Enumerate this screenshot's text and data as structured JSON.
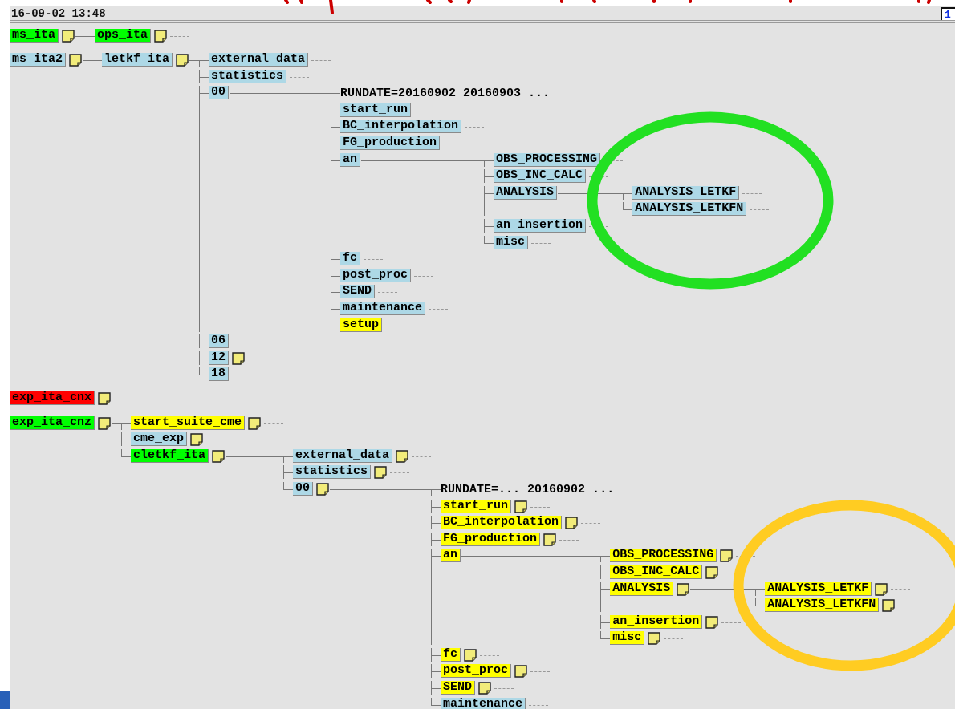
{
  "header": {
    "timestamp": "16-09-02 13:48",
    "page_button": "1"
  },
  "trees": [
    {
      "kind": "node",
      "name": "ms_ita",
      "color": "#00ff00",
      "note": true,
      "children": [
        {
          "kind": "node",
          "name": "ops_ita",
          "color": "#00ff00",
          "note": true
        }
      ]
    },
    {
      "kind": "node",
      "name": "ms_ita2",
      "color": "#add8e6",
      "note": true,
      "children": [
        {
          "kind": "node",
          "name": "letkf_ita",
          "color": "#add8e6",
          "note": true,
          "children": [
            {
              "kind": "node",
              "name": "external_data",
              "color": "#add8e6",
              "note": false
            },
            {
              "kind": "node",
              "name": "statistics",
              "color": "#add8e6",
              "note": false
            },
            {
              "kind": "node",
              "name": "00",
              "color": "#add8e6",
              "note": false,
              "children": [
                {
                  "kind": "label",
                  "text": "RUNDATE=20160902 20160903 ..."
                },
                {
                  "kind": "node",
                  "name": "start_run",
                  "color": "#add8e6",
                  "note": false
                },
                {
                  "kind": "node",
                  "name": "BC_interpolation",
                  "color": "#add8e6",
                  "note": false
                },
                {
                  "kind": "node",
                  "name": "FG_production",
                  "color": "#add8e6",
                  "note": false
                },
                {
                  "kind": "node",
                  "name": "an",
                  "color": "#add8e6",
                  "note": false,
                  "children": [
                    {
                      "kind": "node",
                      "name": "OBS_PROCESSING",
                      "color": "#add8e6",
                      "note": false
                    },
                    {
                      "kind": "node",
                      "name": "OBS_INC_CALC",
                      "color": "#add8e6",
                      "note": false
                    },
                    {
                      "kind": "node",
                      "name": "ANALYSIS",
                      "color": "#add8e6",
                      "note": false,
                      "children": [
                        {
                          "kind": "node",
                          "name": "ANALYSIS_LETKF",
                          "color": "#add8e6",
                          "note": false
                        },
                        {
                          "kind": "node",
                          "name": "ANALYSIS_LETKFN",
                          "color": "#add8e6",
                          "note": false
                        }
                      ]
                    },
                    {
                      "kind": "node",
                      "name": "an_insertion",
                      "color": "#add8e6",
                      "note": false
                    },
                    {
                      "kind": "node",
                      "name": "misc",
                      "color": "#add8e6",
                      "note": false
                    }
                  ]
                },
                {
                  "kind": "node",
                  "name": "fc",
                  "color": "#add8e6",
                  "note": false
                },
                {
                  "kind": "node",
                  "name": "post_proc",
                  "color": "#add8e6",
                  "note": false
                },
                {
                  "kind": "node",
                  "name": "SEND",
                  "color": "#add8e6",
                  "note": false
                },
                {
                  "kind": "node",
                  "name": "maintenance",
                  "color": "#add8e6",
                  "note": false
                },
                {
                  "kind": "node",
                  "name": "setup",
                  "color": "#ffff00",
                  "note": false
                }
              ]
            },
            {
              "kind": "node",
              "name": "06",
              "color": "#add8e6",
              "note": false
            },
            {
              "kind": "node",
              "name": "12",
              "color": "#add8e6",
              "note": true
            },
            {
              "kind": "node",
              "name": "18",
              "color": "#add8e6",
              "note": false
            }
          ]
        }
      ]
    },
    {
      "kind": "node",
      "name": "exp_ita_cnx",
      "color": "#ff0000",
      "note": true
    },
    {
      "kind": "node",
      "name": "exp_ita_cnz",
      "color": "#00ff00",
      "note": true,
      "children": [
        {
          "kind": "node",
          "name": "start_suite_cme",
          "color": "#ffff00",
          "note": true
        },
        {
          "kind": "node",
          "name": "cme_exp",
          "color": "#add8e6",
          "note": true
        },
        {
          "kind": "node",
          "name": "cletkf_ita",
          "color": "#00ff00",
          "note": true,
          "children": [
            {
              "kind": "node",
              "name": "external_data",
              "color": "#add8e6",
              "note": true
            },
            {
              "kind": "node",
              "name": "statistics",
              "color": "#add8e6",
              "note": true
            },
            {
              "kind": "node",
              "name": "00",
              "color": "#add8e6",
              "note": true,
              "children": [
                {
                  "kind": "label",
                  "text": "RUNDATE=... 20160902 ..."
                },
                {
                  "kind": "node",
                  "name": "start_run",
                  "color": "#ffff00",
                  "note": true
                },
                {
                  "kind": "node",
                  "name": "BC_interpolation",
                  "color": "#ffff00",
                  "note": true
                },
                {
                  "kind": "node",
                  "name": "FG_production",
                  "color": "#ffff00",
                  "note": true
                },
                {
                  "kind": "node",
                  "name": "an",
                  "color": "#ffff00",
                  "note": false,
                  "children": [
                    {
                      "kind": "node",
                      "name": "OBS_PROCESSING",
                      "color": "#ffff00",
                      "note": true
                    },
                    {
                      "kind": "node",
                      "name": "OBS_INC_CALC",
                      "color": "#ffff00",
                      "note": true
                    },
                    {
                      "kind": "node",
                      "name": "ANALYSIS",
                      "color": "#ffff00",
                      "note": true,
                      "children": [
                        {
                          "kind": "node",
                          "name": "ANALYSIS_LETKF",
                          "color": "#ffff00",
                          "note": true
                        },
                        {
                          "kind": "node",
                          "name": "ANALYSIS_LETKFN",
                          "color": "#ffff00",
                          "note": true
                        }
                      ]
                    },
                    {
                      "kind": "node",
                      "name": "an_insertion",
                      "color": "#ffff00",
                      "note": true
                    },
                    {
                      "kind": "node",
                      "name": "misc",
                      "color": "#ffff00",
                      "note": true
                    }
                  ]
                },
                {
                  "kind": "node",
                  "name": "fc",
                  "color": "#ffff00",
                  "note": true
                },
                {
                  "kind": "node",
                  "name": "post_proc",
                  "color": "#ffff00",
                  "note": true
                },
                {
                  "kind": "node",
                  "name": "SEND",
                  "color": "#ffff00",
                  "note": true
                },
                {
                  "kind": "node",
                  "name": "maintenance",
                  "color": "#add8e6",
                  "note": false
                }
              ]
            }
          ]
        }
      ]
    }
  ],
  "annotations": [
    {
      "kind": "scribble",
      "color": "#cc0000"
    },
    {
      "kind": "ellipse",
      "color": "#22e022"
    },
    {
      "kind": "ellipse",
      "color": "#ffcc22"
    }
  ]
}
